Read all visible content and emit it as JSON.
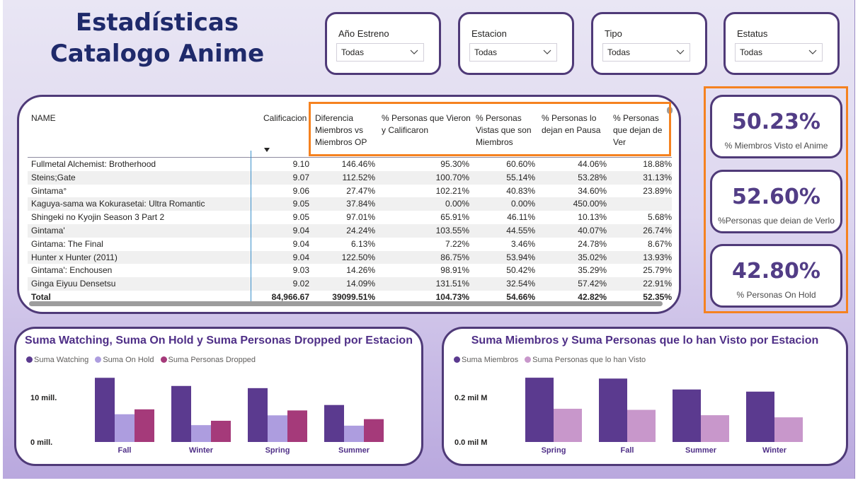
{
  "header": {
    "title_line1": "Estadísticas",
    "title_line2": "Catalogo Anime"
  },
  "slicers": [
    {
      "label": "Año Estreno",
      "value": "Todas"
    },
    {
      "label": "Estacion",
      "value": "Todas"
    },
    {
      "label": "Tipo",
      "value": "Todas"
    },
    {
      "label": "Estatus",
      "value": "Todas"
    }
  ],
  "table": {
    "columns": [
      "NAME",
      "Calificacion",
      "Diferencia Miembros vs Miembros OP",
      "% Personas que Vieron y Calificaron",
      "% Personas Vistas que son Miembros",
      "% Personas lo dejan en Pausa",
      "% Personas que dejan de Ver"
    ],
    "rows": [
      [
        "Fullmetal Alchemist: Brotherhood",
        "9.10",
        "146.46%",
        "95.30%",
        "60.60%",
        "44.06%",
        "18.88%"
      ],
      [
        "Steins;Gate",
        "9.07",
        "112.52%",
        "100.70%",
        "55.14%",
        "53.28%",
        "31.13%"
      ],
      [
        "Gintama°",
        "9.06",
        "27.47%",
        "102.21%",
        "40.83%",
        "34.60%",
        "23.89%"
      ],
      [
        "Kaguya-sama wa Kokurasetai: Ultra Romantic",
        "9.05",
        "37.84%",
        "0.00%",
        "0.00%",
        "450.00%",
        ""
      ],
      [
        "Shingeki no Kyojin Season 3 Part 2",
        "9.05",
        "97.01%",
        "65.91%",
        "46.11%",
        "10.13%",
        "5.68%"
      ],
      [
        "Gintama'",
        "9.04",
        "24.24%",
        "103.55%",
        "44.55%",
        "40.07%",
        "26.74%"
      ],
      [
        "Gintama: The Final",
        "9.04",
        "6.13%",
        "7.22%",
        "3.46%",
        "24.78%",
        "8.67%"
      ],
      [
        "Hunter x Hunter (2011)",
        "9.04",
        "122.50%",
        "86.75%",
        "53.94%",
        "35.02%",
        "13.93%"
      ],
      [
        "Gintama': Enchousen",
        "9.03",
        "14.26%",
        "98.91%",
        "50.42%",
        "35.29%",
        "25.79%"
      ],
      [
        "Ginga Eiyuu Densetsu",
        "9.02",
        "14.09%",
        "131.51%",
        "32.54%",
        "57.42%",
        "22.91%"
      ]
    ],
    "total": [
      "Total",
      "84,966.67",
      "39099.51%",
      "104.73%",
      "54.66%",
      "42.82%",
      "52.35%"
    ]
  },
  "kpis": [
    {
      "value": "50.23%",
      "label": "% Miembros Visto el Anime"
    },
    {
      "value": "52.60%",
      "label": "%Personas que deian de Verlo"
    },
    {
      "value": "42.80%",
      "label": "% Personas On Hold"
    }
  ],
  "colors": {
    "dark_purple": "#5b3a8f",
    "light_purple": "#ad9ddf",
    "magenta": "#a53a7a",
    "pale_purple": "#c897cb",
    "highlight_orange": "#f58220"
  },
  "chart_data": [
    {
      "type": "bar",
      "title": "Suma Watching, Suma On Hold y Suma Personas Dropped por Estacion",
      "categories": [
        "Fall",
        "Winter",
        "Spring",
        "Summer"
      ],
      "series": [
        {
          "name": "Suma Watching",
          "values": [
            11.8,
            10.3,
            9.9,
            6.8
          ]
        },
        {
          "name": "Suma On Hold",
          "values": [
            5.1,
            3.1,
            4.9,
            3.0
          ]
        },
        {
          "name": "Suma Personas Dropped",
          "values": [
            6.0,
            3.9,
            5.8,
            4.2
          ]
        }
      ],
      "yticks": [
        "10 mill.",
        "0 mill."
      ],
      "ylim": [
        0,
        13
      ]
    },
    {
      "type": "bar",
      "title": "Suma Miembros y Suma Personas que lo han Visto por Estacion",
      "categories": [
        "Spring",
        "Fall",
        "Summer",
        "Winter"
      ],
      "series": [
        {
          "name": "Suma Miembros",
          "values": [
            0.3,
            0.296,
            0.245,
            0.235
          ]
        },
        {
          "name": "Suma Personas que lo han Visto",
          "values": [
            0.155,
            0.15,
            0.125,
            0.115
          ]
        }
      ],
      "yticks": [
        "0.2 mil M",
        "0.0 mil M"
      ],
      "ylim": [
        0,
        0.33
      ]
    }
  ]
}
